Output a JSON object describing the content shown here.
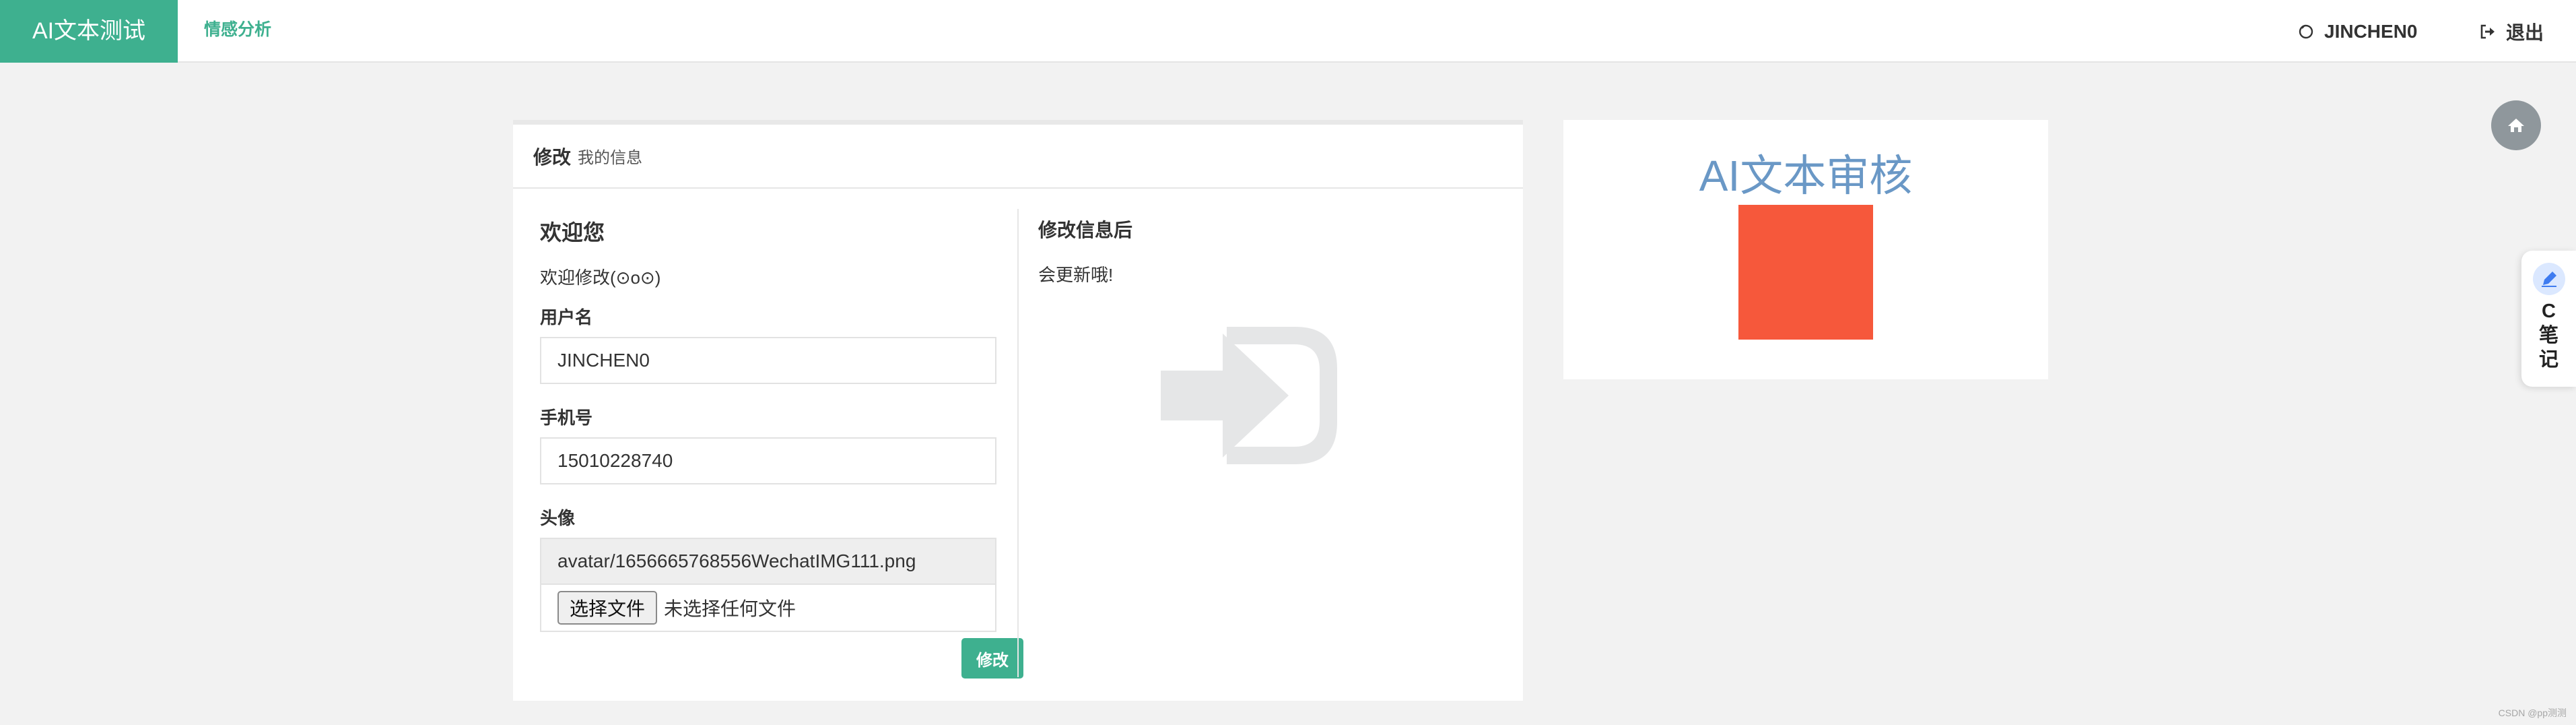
{
  "topbar": {
    "brand": "AI文本测试",
    "nav_link": "情感分析",
    "username": "JINCHEN0",
    "logout": "退出"
  },
  "panel": {
    "header_title": "修改",
    "header_subtitle": "我的信息",
    "left": {
      "welcome_title": "欢迎您",
      "welcome_text": "欢迎修改(⊙o⊙)",
      "username_label": "用户名",
      "username_value": "JINCHEN0",
      "phone_label": "手机号",
      "phone_value": "15010228740",
      "avatar_label": "头像",
      "avatar_path": "avatar/1656665768556WechatIMG111.png",
      "file_button": "选择文件",
      "file_status": "未选择任何文件",
      "submit": "修改"
    },
    "right": {
      "title": "修改信息后",
      "text": "会更新哦!"
    }
  },
  "side_panel": {
    "title": "AI文本审核",
    "image_color": "#f6583b"
  },
  "floating": {
    "cnote_text": "C笔记"
  },
  "watermark": "CSDN @pp测测",
  "colors": {
    "accent": "#3eb08f",
    "side_title": "#6a98c6"
  },
  "icons": [
    "user-icon",
    "logout-icon",
    "home-icon",
    "pen-icon",
    "sign-in-icon"
  ]
}
